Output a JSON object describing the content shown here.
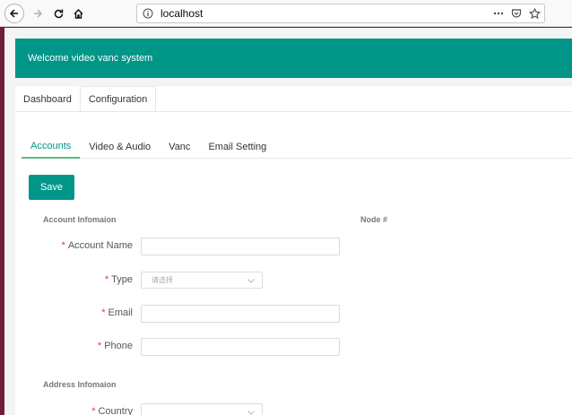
{
  "browser": {
    "url": "localhost"
  },
  "header": {
    "welcome": "Welcome video vanc system"
  },
  "top_tabs": [
    {
      "label": "Dashboard"
    },
    {
      "label": "Configuration"
    }
  ],
  "sub_tabs": [
    {
      "label": "Accounts"
    },
    {
      "label": "Video & Audio"
    },
    {
      "label": "Vanc"
    },
    {
      "label": "Email Setting"
    }
  ],
  "form": {
    "save_label": "Save",
    "account_section": "Account Infomaion",
    "node_label": "Node #",
    "account_name_label": "Account Name",
    "type_label": "Type",
    "type_placeholder": "请选择",
    "email_label": "Email",
    "phone_label": "Phone",
    "address_section": "Address Infomaion",
    "country_label": "Country",
    "required_mark": "*"
  },
  "colors": {
    "accent": "#009688",
    "tab_underline": "#5fb878",
    "required": "#e53935"
  }
}
